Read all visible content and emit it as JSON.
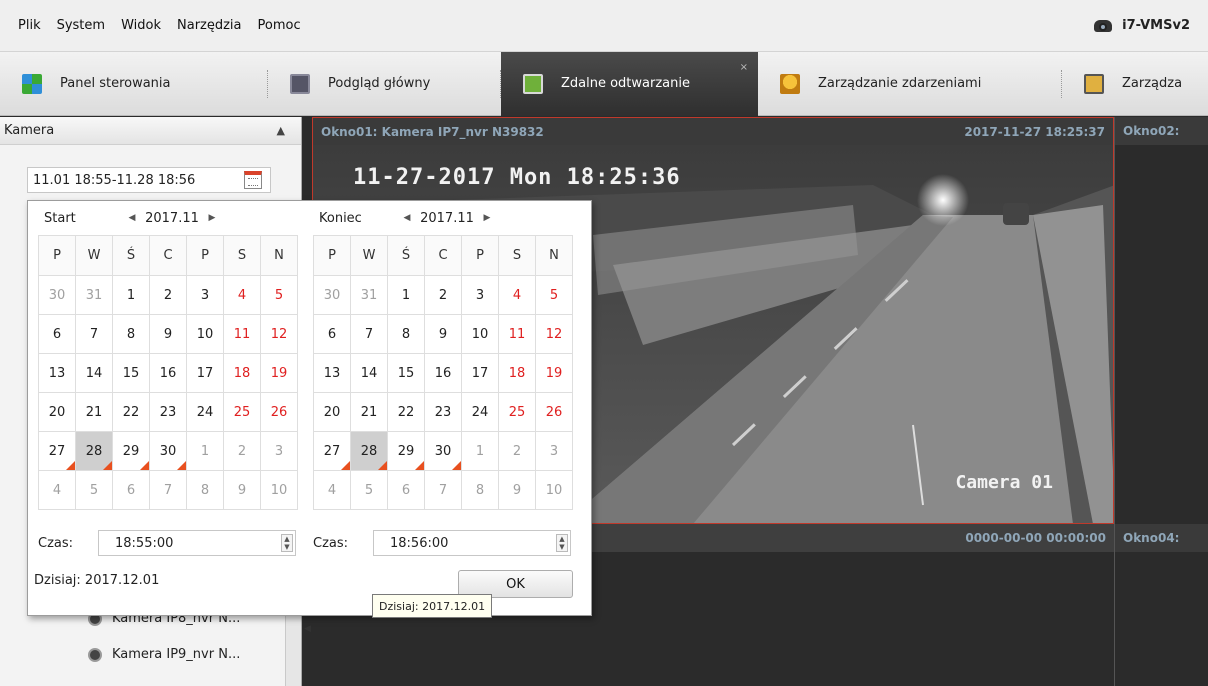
{
  "menu": [
    "Plik",
    "System",
    "Widok",
    "Narzędzia",
    "Pomoc"
  ],
  "brand": "i7-VMSv2",
  "tabs": [
    {
      "label": "Panel sterowania",
      "icon": "grid-icon"
    },
    {
      "label": "Podgląd główny",
      "icon": "monitor-icon"
    },
    {
      "label": "Zdalne odtwarzanie",
      "icon": "replay-icon",
      "active": true,
      "close": "×"
    },
    {
      "label": "Zarządzanie zdarzeniami",
      "icon": "alarm-icon"
    },
    {
      "label": "Zarządza",
      "icon": "manage-icon"
    }
  ],
  "left_panel": {
    "title": "Kamera",
    "date_range": "11.01 18:55-11.28 18:56",
    "tree": [
      "Kamera IP8_nvr N...",
      "Kamera IP9_nvr N..."
    ]
  },
  "calendar": {
    "start": {
      "label": "Start",
      "month": "2017.11",
      "time_label": "Czas:",
      "time": "18:55:00"
    },
    "end": {
      "label": "Koniec",
      "month": "2017.11",
      "time_label": "Czas:",
      "time": "18:56:00"
    },
    "weekdays": [
      "P",
      "W",
      "Ś",
      "C",
      "P",
      "S",
      "N"
    ],
    "weeks": [
      [
        "30",
        "31",
        "1",
        "2",
        "3",
        "4",
        "5"
      ],
      [
        "6",
        "7",
        "8",
        "9",
        "10",
        "11",
        "12"
      ],
      [
        "13",
        "14",
        "15",
        "16",
        "17",
        "18",
        "19"
      ],
      [
        "20",
        "21",
        "22",
        "23",
        "24",
        "25",
        "26"
      ],
      [
        "27",
        "28",
        "29",
        "30",
        "1",
        "2",
        "3"
      ],
      [
        "4",
        "5",
        "6",
        "7",
        "8",
        "9",
        "10"
      ]
    ],
    "today": "Dzisiaj: 2017.12.01",
    "ok": "OK",
    "tooltip": "Dzisiaj: 2017.12.01",
    "selected_day": "28",
    "recorded_days": [
      "27",
      "28",
      "29",
      "30"
    ]
  },
  "video": {
    "win1": {
      "title": "Okno01:  Kamera IP7_nvr N39832",
      "time": "2017-11-27 18:25:37"
    },
    "win2": {
      "title": "Okno02:"
    },
    "win3": {
      "time": "0000-00-00 00:00:00"
    },
    "win4": {
      "title": "Okno04:"
    },
    "osd_date": "11-27-2017 Mon 18:25:36",
    "osd_camera": "Camera 01"
  },
  "colors": {
    "accent_red": "#c0392b",
    "weekend": "#e02020",
    "record_marker": "#e8501f"
  }
}
